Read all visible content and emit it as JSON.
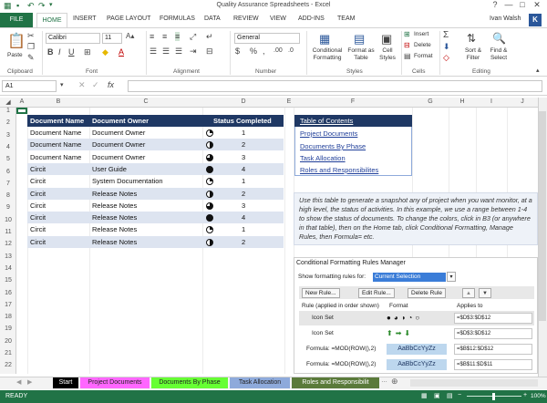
{
  "app": {
    "title": "Quality Assurance Spreadsheets - Excel",
    "user": "Ivan Walsh",
    "avatar_letter": "K",
    "win_help": "?",
    "win_min": "—",
    "win_max": "□",
    "win_close": "✕"
  },
  "ribbon_tabs": [
    "FILE",
    "HOME",
    "INSERT",
    "PAGE LAYOUT",
    "FORMULAS",
    "DATA",
    "REVIEW",
    "VIEW",
    "ADD-INS",
    "TEAM"
  ],
  "ribbon": {
    "paste_label": "Paste",
    "font_name": "Calibri",
    "font_size": "11",
    "number_format": "General",
    "cond_fmt_label": "Conditional Formatting",
    "format_table_label": "Format as Table",
    "cell_styles_label": "Cell Styles",
    "insert_label": "Insert",
    "delete_label": "Delete",
    "format_label": "Format",
    "sort_label": "Sort & Filter",
    "find_label": "Find & Select",
    "groups": [
      "Clipboard",
      "Font",
      "Alignment",
      "Number",
      "Styles",
      "Cells",
      "Editing"
    ],
    "dollar": "$",
    "percent": "%",
    "comma": ","
  },
  "formula_bar": {
    "name_box": "A1",
    "fx": "fx",
    "value": ""
  },
  "columns": [
    "A",
    "B",
    "C",
    "D",
    "E",
    "F",
    "G",
    "H",
    "I",
    "J"
  ],
  "rows": [
    "1",
    "2",
    "3",
    "4",
    "5",
    "6",
    "7",
    "8",
    "9",
    "10",
    "11",
    "12",
    "13",
    "14",
    "15",
    "16",
    "17",
    "18",
    "19",
    "20",
    "21",
    "22"
  ],
  "main_table": {
    "headers": [
      "Document Name",
      "Document Owner",
      "Status Completed"
    ],
    "rows": [
      {
        "name": "Document Name",
        "owner": "Document Owner",
        "status": 1
      },
      {
        "name": "Document Name",
        "owner": "Document Owner",
        "status": 2
      },
      {
        "name": "Document Name",
        "owner": "Document Owner",
        "status": 3
      },
      {
        "name": "Circit",
        "owner": "User Guide",
        "status": 4
      },
      {
        "name": "Circit",
        "owner": "System Documentation",
        "status": 1
      },
      {
        "name": "Circit",
        "owner": "Release Notes",
        "status": 2
      },
      {
        "name": "Circit",
        "owner": "Release Notes",
        "status": 3
      },
      {
        "name": "Circit",
        "owner": "Release Notes",
        "status": 4
      },
      {
        "name": "Circit",
        "owner": "Release Notes",
        "status": 1
      },
      {
        "name": "Circit",
        "owner": "Release Notes",
        "status": 2
      }
    ]
  },
  "toc": {
    "title": "Table of Contents",
    "items": [
      "Project Documents",
      "Documents By Phase",
      "Task Allocation",
      "Roles and Responsibilites"
    ]
  },
  "info_text": "Use this table to generate a snapshot any of project when you want monitor, at a high level, the status of activities. In this example, we use a range between 1-4 to show the status of documents. To change the colors, click in B3 (or anywhere in that table), then on the Home tab, click Conditional Formatting, Manage Rules, then Formula= etc.",
  "cf_manager": {
    "title": "Conditional Formatting Rules Manager",
    "show_label": "Show formatting rules for:",
    "show_value": "Current Selection",
    "new_rule": "New Rule...",
    "edit_rule": "Edit Rule...",
    "delete_rule": "Delete Rule",
    "col_rule": "Rule (applied in order shown)",
    "col_format": "Format",
    "col_applies": "Applies to",
    "rules": [
      {
        "rule": "Icon Set",
        "format": "●◕◑◔○",
        "applies": "=$D$3:$D$12"
      },
      {
        "rule": "Icon Set",
        "format": "⬆➡⬇",
        "applies": "=$D$3:$D$12"
      },
      {
        "rule": "Formula: =MOD(ROW(),2)",
        "format": "AaBbCcYyZz",
        "applies": "=$B$12:$D$12"
      },
      {
        "rule": "Formula: =MOD(ROW(),2)",
        "format": "AaBbCcYyZz",
        "applies": "=$B$11:$D$11"
      }
    ]
  },
  "sheet_tabs": [
    {
      "label": "Start",
      "bg": "#000000",
      "fg": "#ffffff"
    },
    {
      "label": "Project Documents",
      "bg": "#ff66ff",
      "fg": "#222222"
    },
    {
      "label": "Documents By Phase",
      "bg": "#66ff33",
      "fg": "#222222"
    },
    {
      "label": "Task Allocation",
      "bg": "#8eaadb",
      "fg": "#222222"
    },
    {
      "label": "Roles and Responsibilit",
      "bg": "#5a7a3a",
      "fg": "#ffffff"
    }
  ],
  "status_bar": {
    "mode": "READY",
    "zoom": "100%"
  },
  "colors": {
    "accent": "#217346",
    "header": "#1f3864",
    "band": "#dde4f0"
  }
}
